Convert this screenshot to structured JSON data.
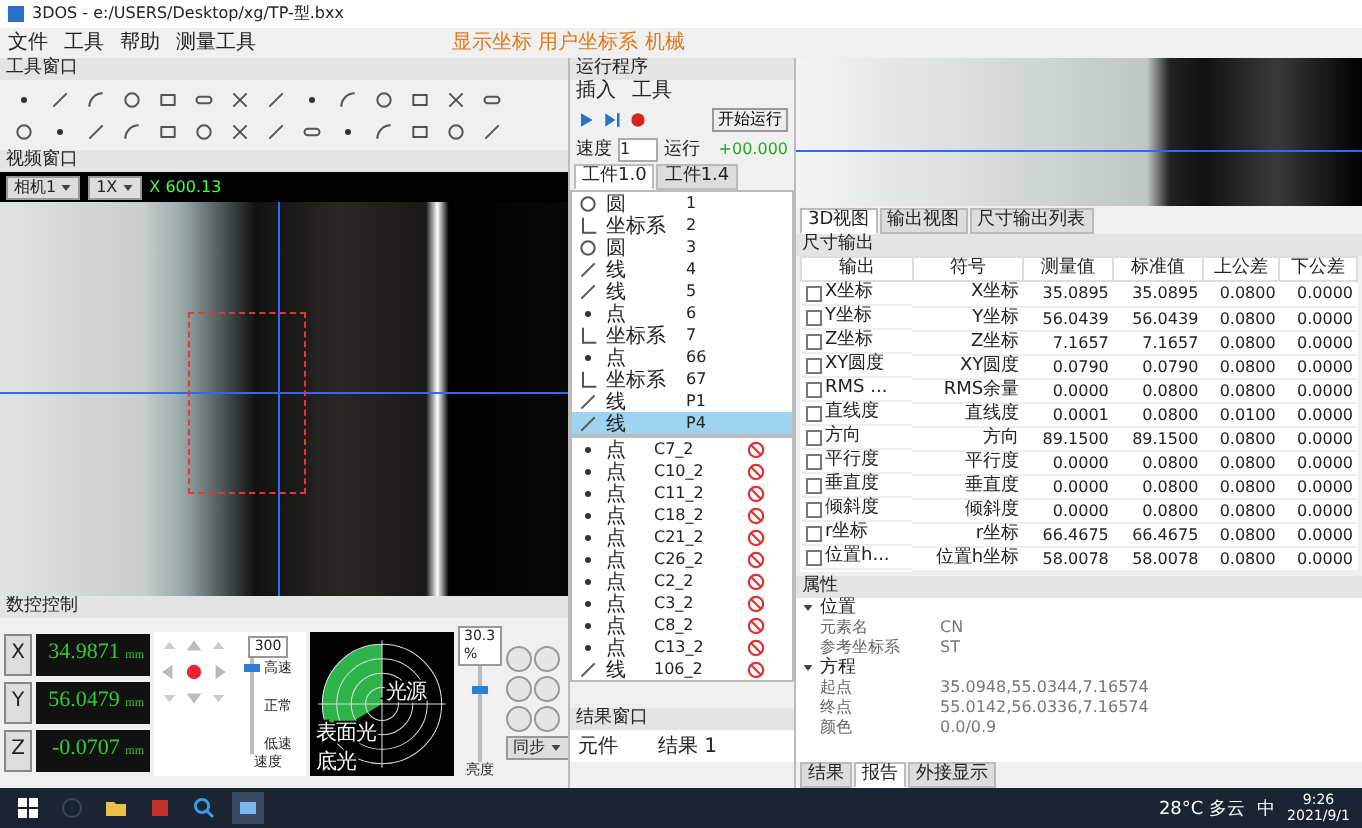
{
  "window": {
    "title": "3DOS - e:/USERS/Desktop/xg/TP-型.bxx"
  },
  "menu": [
    "文件",
    "工具",
    "帮助",
    "测量工具"
  ],
  "menu_status": "显示坐标 用户坐标系 机械",
  "tool_window": {
    "title": "工具窗口"
  },
  "video_window": {
    "title": "视频窗口",
    "camera": "相机1",
    "zoom": "1X",
    "reading": "X 600.13"
  },
  "motion_control": {
    "title": "数控控制",
    "axes": [
      {
        "label": "X",
        "value": "34.9871",
        "unit": "mm"
      },
      {
        "label": "Y",
        "value": "56.0479",
        "unit": "mm"
      },
      {
        "label": "Z",
        "value": "-0.0707",
        "unit": "mm"
      }
    ],
    "speed": {
      "value": "300",
      "level": 0.85,
      "labels": [
        "高速",
        "正常",
        "低速"
      ],
      "caption": "速度"
    },
    "light": {
      "labels": [
        "光源",
        "表面光",
        "底光"
      ],
      "value": "30.3",
      "unit": "%",
      "level": 0.7,
      "caption": "亮度",
      "mode": "同步"
    }
  },
  "program": {
    "title": "运行程序",
    "menu": [
      "插入",
      "工具"
    ],
    "run_button": "开始运行",
    "speed_label": "速度",
    "speed": "1",
    "run_label": "运行",
    "offset": "+00.000",
    "tabs": [
      {
        "label": "工件1.0",
        "selected": true
      },
      {
        "label": "工件1.4",
        "selected": false
      }
    ],
    "steps": [
      {
        "kind": "circle",
        "name": "圆",
        "number": "1",
        "selected": false
      },
      {
        "kind": "coordinate",
        "name": "坐标系",
        "number": "2",
        "selected": false
      },
      {
        "kind": "circle",
        "name": "圆",
        "number": "3",
        "selected": false
      },
      {
        "kind": "line",
        "name": "线",
        "number": "4",
        "selected": false
      },
      {
        "kind": "line",
        "name": "线",
        "number": "5",
        "selected": false
      },
      {
        "kind": "point",
        "name": "点",
        "number": "6",
        "selected": false
      },
      {
        "kind": "coordinate",
        "name": "坐标系",
        "number": "7",
        "selected": false
      },
      {
        "kind": "point",
        "name": "点",
        "number": "66",
        "selected": false
      },
      {
        "kind": "coordinate",
        "name": "坐标系",
        "number": "67",
        "selected": false
      },
      {
        "kind": "line",
        "name": "线",
        "number": "P1",
        "selected": false
      },
      {
        "kind": "line",
        "name": "线",
        "number": "P4",
        "selected": true
      }
    ],
    "results": [
      {
        "kind": "point",
        "name": "点",
        "id": "C7_2"
      },
      {
        "kind": "point",
        "name": "点",
        "id": "C10_2"
      },
      {
        "kind": "point",
        "name": "点",
        "id": "C11_2"
      },
      {
        "kind": "point",
        "name": "点",
        "id": "C18_2"
      },
      {
        "kind": "point",
        "name": "点",
        "id": "C21_2"
      },
      {
        "kind": "point",
        "name": "点",
        "id": "C26_2"
      },
      {
        "kind": "point",
        "name": "点",
        "id": "C2_2"
      },
      {
        "kind": "point",
        "name": "点",
        "id": "C3_2"
      },
      {
        "kind": "point",
        "name": "点",
        "id": "C8_2"
      },
      {
        "kind": "point",
        "name": "点",
        "id": "C13_2"
      },
      {
        "kind": "line",
        "name": "线",
        "id": "106_2"
      }
    ]
  },
  "result_window": {
    "title": "结果窗口",
    "columns": [
      "元件",
      "结果 1"
    ]
  },
  "view_tabs": [
    {
      "label": "3D视图",
      "selected": true
    },
    {
      "label": "输出视图",
      "selected": false
    },
    {
      "label": "尺寸输出列表",
      "selected": false
    }
  ],
  "dimension_output": {
    "title": "尺寸输出",
    "columns": [
      "输出",
      "符号",
      "测量值",
      "标准值",
      "上公差",
      "下公差"
    ],
    "rows": [
      {
        "checked": false,
        "output": "X坐标",
        "symbol": "X坐标",
        "measured": "35.0895",
        "nominal": "35.0895",
        "upper": "0.0800",
        "lower": "0.0000"
      },
      {
        "checked": false,
        "output": "Y坐标",
        "symbol": "Y坐标",
        "measured": "56.0439",
        "nominal": "56.0439",
        "upper": "0.0800",
        "lower": "0.0000"
      },
      {
        "checked": false,
        "output": "Z坐标",
        "symbol": "Z坐标",
        "measured": "7.1657",
        "nominal": "7.1657",
        "upper": "0.0800",
        "lower": "0.0000"
      },
      {
        "checked": false,
        "output": "XY圆度",
        "symbol": "XY圆度",
        "measured": "0.0790",
        "nominal": "0.0790",
        "upper": "0.0800",
        "lower": "0.0000"
      },
      {
        "checked": false,
        "output": "RMS ...",
        "symbol": "RMS余量",
        "measured": "0.0000",
        "nominal": "0.0800",
        "upper": "0.0800",
        "lower": "0.0000"
      },
      {
        "checked": false,
        "output": "直线度",
        "symbol": "直线度",
        "measured": "0.0001",
        "nominal": "0.0800",
        "upper": "0.0100",
        "lower": "0.0000"
      },
      {
        "checked": false,
        "output": "方向",
        "symbol": "方向",
        "measured": "89.1500",
        "nominal": "89.1500",
        "upper": "0.0800",
        "lower": "0.0000"
      },
      {
        "checked": false,
        "output": "平行度",
        "symbol": "平行度",
        "measured": "0.0000",
        "nominal": "0.0800",
        "upper": "0.0800",
        "lower": "0.0000"
      },
      {
        "checked": false,
        "output": "垂直度",
        "symbol": "垂直度",
        "measured": "0.0000",
        "nominal": "0.0800",
        "upper": "0.0800",
        "lower": "0.0000"
      },
      {
        "checked": false,
        "output": "倾斜度",
        "symbol": "倾斜度",
        "measured": "0.0000",
        "nominal": "0.0800",
        "upper": "0.0800",
        "lower": "0.0000"
      },
      {
        "checked": false,
        "output": "r坐标",
        "symbol": "r坐标",
        "measured": "66.4675",
        "nominal": "66.4675",
        "upper": "0.0800",
        "lower": "0.0000"
      },
      {
        "checked": false,
        "output": "位置h...",
        "symbol": "位置h坐标",
        "measured": "58.0078",
        "nominal": "58.0078",
        "upper": "0.0800",
        "lower": "0.0000"
      }
    ]
  },
  "properties": {
    "title": "属性",
    "groups": [
      {
        "name": "位置",
        "expanded": true,
        "rows": [
          {
            "key": "元素名",
            "value": "CN"
          },
          {
            "key": "参考坐标系",
            "value": "ST"
          }
        ]
      },
      {
        "name": "方程",
        "expanded": true,
        "rows": [
          {
            "key": "起点",
            "value": "35.0948,55.0344,7.16574"
          },
          {
            "key": "终点",
            "value": "55.0142,56.0336,7.16574"
          },
          {
            "key": "颜色",
            "value": "0.0/0.9"
          }
        ]
      }
    ]
  },
  "bottom_tabs": [
    {
      "label": "结果",
      "selected": false
    },
    {
      "label": "报告",
      "selected": true
    },
    {
      "label": "外接显示",
      "selected": false
    }
  ],
  "taskbar": {
    "weather": "28°C 多云",
    "ime": "中",
    "time": "9:26",
    "date": "2021/9/1"
  }
}
